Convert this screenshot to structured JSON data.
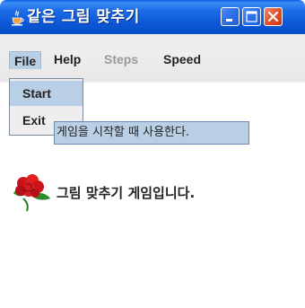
{
  "window": {
    "title": "같은 그림 맞추기",
    "icon": "java-cup-icon"
  },
  "menubar": {
    "items": [
      {
        "label": "File",
        "state": "open"
      },
      {
        "label": "Help",
        "state": "enabled"
      },
      {
        "label": "Steps",
        "state": "disabled"
      },
      {
        "label": "Speed",
        "state": "enabled"
      }
    ]
  },
  "file_menu": {
    "items": [
      {
        "label": "Start",
        "state": "highlighted"
      },
      {
        "label": "Exit",
        "state": "enabled"
      }
    ]
  },
  "tooltip": {
    "text": "게임을 시작할 때 사용한다."
  },
  "content": {
    "image": "red-flower-icon",
    "text": "그림 맞추기 게임입니다."
  },
  "colors": {
    "titlebar": "#0b56d6",
    "menu_highlight": "#b8cfe5",
    "disabled_text": "#9a9a9a",
    "flower_red": "#d81f1f"
  }
}
